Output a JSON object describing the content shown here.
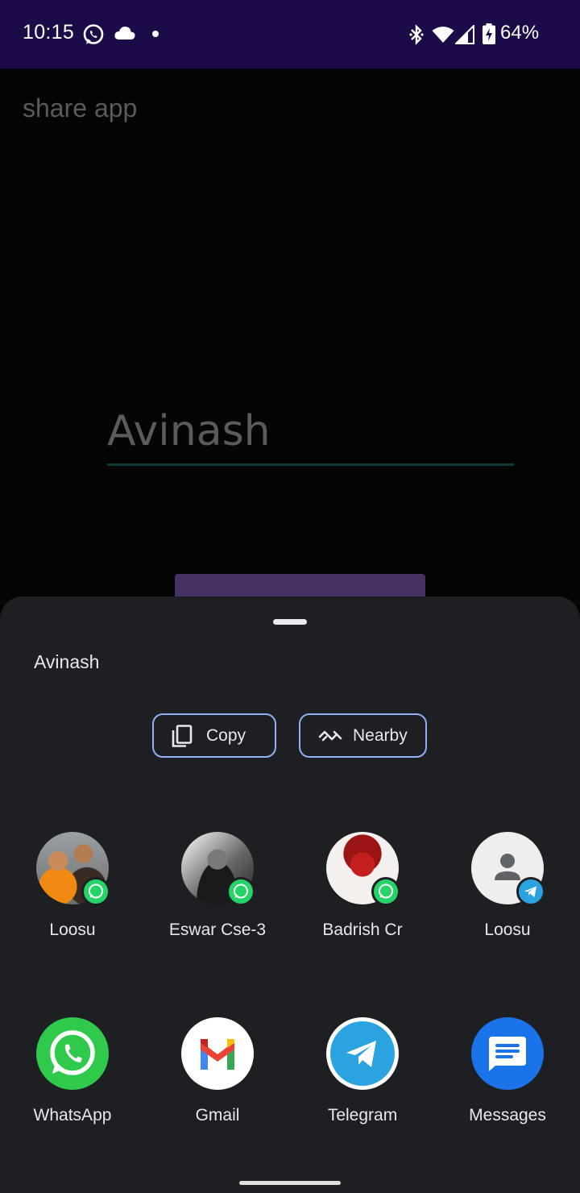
{
  "status_bar": {
    "time": "10:15",
    "battery_percent": "64%",
    "icons": [
      "whatsapp-icon",
      "cloud-icon",
      "notification-dot-icon",
      "bluetooth-icon",
      "wifi-icon",
      "signal-icon",
      "battery-charging-icon"
    ]
  },
  "app": {
    "title": "share app",
    "input_value": "Avinash"
  },
  "share_sheet": {
    "preview_text": "Avinash",
    "actions": [
      {
        "label": "Copy",
        "icon": "copy-icon"
      },
      {
        "label": "Nearby",
        "icon": "nearby-share-icon"
      }
    ],
    "direct_share": [
      {
        "label": "Loosu",
        "badge": "whatsapp-badge-icon"
      },
      {
        "label": "Eswar Cse-3",
        "badge": "whatsapp-badge-icon"
      },
      {
        "label": "Badrish Cr",
        "badge": "whatsapp-badge-icon"
      },
      {
        "label": "Loosu",
        "badge": "telegram-badge-icon"
      }
    ],
    "apps": [
      {
        "label": "WhatsApp",
        "icon": "whatsapp-icon"
      },
      {
        "label": "Gmail",
        "icon": "gmail-icon"
      },
      {
        "label": "Telegram",
        "icon": "telegram-icon"
      },
      {
        "label": "Messages",
        "icon": "messages-icon"
      }
    ]
  },
  "colors": {
    "status_bar_bg": "#1d0a48",
    "sheet_bg": "#1e1f23",
    "chip_border": "#8fb0f5",
    "whatsapp_green": "#25d366",
    "telegram_blue": "#2aa3e0",
    "messages_blue": "#1a73e8"
  }
}
